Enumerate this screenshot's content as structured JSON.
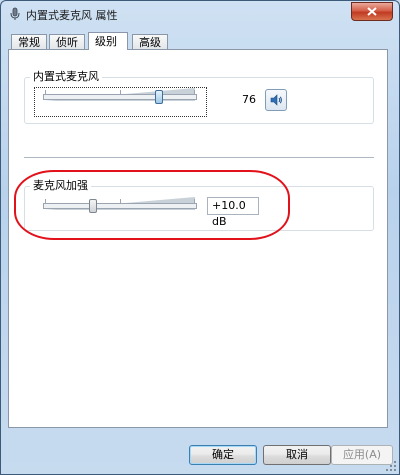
{
  "window": {
    "title": "内置式麦克风 属性"
  },
  "tabs": [
    {
      "label": "常规",
      "active": false
    },
    {
      "label": "侦听",
      "active": false
    },
    {
      "label": "级别",
      "active": true
    },
    {
      "label": "高级",
      "active": false
    }
  ],
  "microphone": {
    "label": "内置式麦克风",
    "value": "76",
    "level_fraction": 0.76
  },
  "boost": {
    "label": "麦克风加强",
    "value": "+10.0 dB",
    "level_fraction": 0.33
  },
  "buttons": {
    "ok": "确定",
    "cancel": "取消",
    "apply": "应用(A)"
  },
  "colors": {
    "highlight": "#e2121b",
    "title_bar": "#c9dcef"
  },
  "icons": {
    "title": "microphone-icon",
    "close": "close-icon",
    "mute": "speaker-icon"
  }
}
